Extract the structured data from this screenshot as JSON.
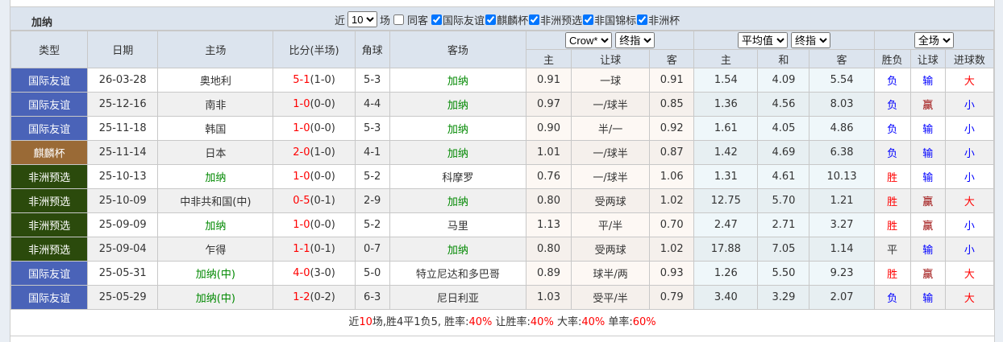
{
  "team": "加纳",
  "filters": {
    "near": "近",
    "count": "10",
    "unit": "场",
    "same_venue": "同客",
    "same_checked": false,
    "competitions": [
      {
        "label": "国际友谊",
        "checked": true
      },
      {
        "label": "麒麟杯",
        "checked": true
      },
      {
        "label": "非洲预选",
        "checked": true
      },
      {
        "label": "非国锦标",
        "checked": true
      },
      {
        "label": "非洲杯",
        "checked": true
      }
    ]
  },
  "headers": {
    "type": "类型",
    "date": "日期",
    "home": "主场",
    "score": "比分(半场)",
    "corner": "角球",
    "away": "客场",
    "company": "Crow*",
    "ah_mode": "终指",
    "avg": "平均值",
    "eu_mode": "终指",
    "period": "全场",
    "sub": [
      "主",
      "让球",
      "客",
      "主",
      "和",
      "客",
      "胜负",
      "让球",
      "进球数"
    ]
  },
  "colors": {
    "friendly": "#4a63b8",
    "kirin": "#9a6a36",
    "afq": "#2b4a0c"
  },
  "rows": [
    {
      "type": "国际友谊",
      "tc": "friendly",
      "date": "26-03-28",
      "home": "奥地利",
      "hg": false,
      "ft": "5-1",
      "ht": "(1-0)",
      "corner": "5-3",
      "away": "加纳",
      "ag": true,
      "h": "0.91",
      "line": "一球",
      "a": "0.91",
      "o1": "1.54",
      "ox": "4.09",
      "o2": "5.54",
      "wl": "负",
      "ah": "输",
      "ou": "大"
    },
    {
      "type": "国际友谊",
      "tc": "friendly",
      "date": "25-12-16",
      "home": "南非",
      "hg": false,
      "ft": "1-0",
      "ht": "(0-0)",
      "corner": "4-4",
      "away": "加纳",
      "ag": true,
      "h": "0.97",
      "line": "一/球半",
      "a": "0.85",
      "o1": "1.36",
      "ox": "4.56",
      "o2": "8.03",
      "wl": "负",
      "ah": "赢",
      "ou": "小"
    },
    {
      "type": "国际友谊",
      "tc": "friendly",
      "date": "25-11-18",
      "home": "韩国",
      "hg": false,
      "ft": "1-0",
      "ht": "(0-0)",
      "corner": "5-3",
      "away": "加纳",
      "ag": true,
      "h": "0.90",
      "line": "半/一",
      "a": "0.92",
      "o1": "1.61",
      "ox": "4.05",
      "o2": "4.86",
      "wl": "负",
      "ah": "输",
      "ou": "小"
    },
    {
      "type": "麒麟杯",
      "tc": "kirin",
      "date": "25-11-14",
      "home": "日本",
      "hg": false,
      "ft": "2-0",
      "ht": "(1-0)",
      "corner": "4-1",
      "away": "加纳",
      "ag": true,
      "h": "1.01",
      "line": "一/球半",
      "a": "0.87",
      "o1": "1.42",
      "ox": "4.69",
      "o2": "6.38",
      "wl": "负",
      "ah": "输",
      "ou": "小"
    },
    {
      "type": "非洲预选",
      "tc": "afq",
      "date": "25-10-13",
      "home": "加纳",
      "hg": true,
      "ft": "1-0",
      "ht": "(0-0)",
      "corner": "5-2",
      "away": "科摩罗",
      "ag": false,
      "h": "0.76",
      "line": "一/球半",
      "a": "1.06",
      "o1": "1.31",
      "ox": "4.61",
      "o2": "10.13",
      "wl": "胜",
      "ah": "输",
      "ou": "小"
    },
    {
      "type": "非洲预选",
      "tc": "afq",
      "date": "25-10-09",
      "home": "中非共和国(中)",
      "hg": false,
      "ft": "0-5",
      "ht": "(0-1)",
      "corner": "2-9",
      "away": "加纳",
      "ag": true,
      "h": "0.80",
      "line": "受两球",
      "a": "1.02",
      "o1": "12.75",
      "ox": "5.70",
      "o2": "1.21",
      "wl": "胜",
      "ah": "赢",
      "ou": "大"
    },
    {
      "type": "非洲预选",
      "tc": "afq",
      "date": "25-09-09",
      "home": "加纳",
      "hg": true,
      "ft": "1-0",
      "ht": "(0-0)",
      "corner": "5-2",
      "away": "马里",
      "ag": false,
      "h": "1.13",
      "line": "平/半",
      "a": "0.70",
      "o1": "2.47",
      "ox": "2.71",
      "o2": "3.27",
      "wl": "胜",
      "ah": "赢",
      "ou": "小"
    },
    {
      "type": "非洲预选",
      "tc": "afq",
      "date": "25-09-04",
      "home": "乍得",
      "hg": false,
      "ft": "1-1",
      "ht": "(0-1)",
      "corner": "0-7",
      "away": "加纳",
      "ag": true,
      "h": "0.80",
      "line": "受两球",
      "a": "1.02",
      "o1": "17.88",
      "ox": "7.05",
      "o2": "1.14",
      "wl": "平",
      "ah": "输",
      "ou": "小"
    },
    {
      "type": "国际友谊",
      "tc": "friendly",
      "date": "25-05-31",
      "home": "加纳(中)",
      "hg": true,
      "ft": "4-0",
      "ht": "(3-0)",
      "corner": "5-0",
      "away": "特立尼达和多巴哥",
      "ag": false,
      "h": "0.89",
      "line": "球半/两",
      "a": "0.93",
      "o1": "1.26",
      "ox": "5.50",
      "o2": "9.23",
      "wl": "胜",
      "ah": "赢",
      "ou": "大"
    },
    {
      "type": "国际友谊",
      "tc": "friendly",
      "date": "25-05-29",
      "home": "加纳(中)",
      "hg": true,
      "ft": "1-2",
      "ht": "(0-2)",
      "corner": "6-3",
      "away": "尼日利亚",
      "ag": false,
      "h": "1.03",
      "line": "受平/半",
      "a": "0.79",
      "o1": "3.40",
      "ox": "3.29",
      "o2": "2.07",
      "wl": "负",
      "ah": "输",
      "ou": "大"
    }
  ],
  "summary": {
    "p1": "近",
    "n": "10",
    "p2": "场,胜4平1负5, 胜率:",
    "win": "40%",
    "p3": " 让胜率:",
    "ahwin": "40%",
    "p4": " 大率:",
    "over": "40%",
    "p5": " 单率:",
    "odd": "60%"
  }
}
